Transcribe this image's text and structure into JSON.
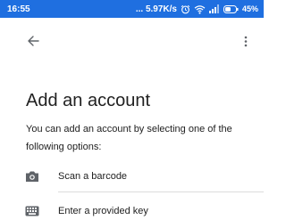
{
  "status_bar": {
    "time": "16:55",
    "network_speed": "... 5.97K/s",
    "battery_percent": "45%",
    "icons": [
      "alarm-icon",
      "wifi-icon",
      "signal-icon",
      "battery-icon"
    ]
  },
  "toolbar": {
    "back_icon": "arrow-back-icon",
    "more_icon": "more-vert-icon"
  },
  "page": {
    "title": "Add an account",
    "description": "You can add an account by selecting one of the following options:"
  },
  "options": [
    {
      "label": "Scan a barcode",
      "icon": "camera-icon"
    },
    {
      "label": "Enter a provided key",
      "icon": "keyboard-icon"
    }
  ],
  "colors": {
    "status_bar": "#1f6fe0",
    "icon_gray": "#5f6368",
    "text": "#212121"
  }
}
